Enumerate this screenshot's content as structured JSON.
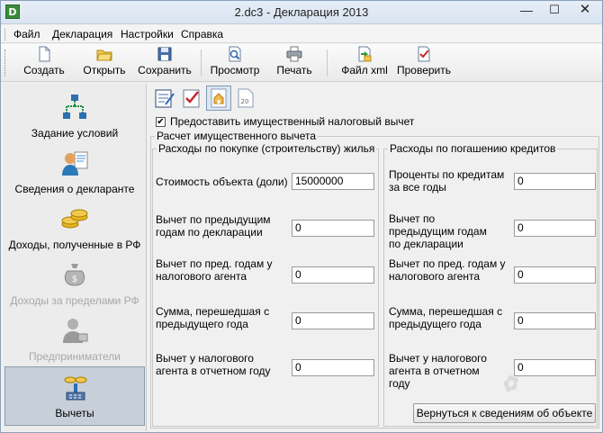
{
  "window": {
    "title": "2.dc3 - Декларация 2013"
  },
  "menu": [
    "Файл",
    "Декларация",
    "Настройки",
    "Справка"
  ],
  "toolbar": {
    "create": "Создать",
    "open": "Открыть",
    "save": "Сохранить",
    "preview": "Просмотр",
    "print": "Печать",
    "xml": "Файл xml",
    "check": "Проверить"
  },
  "sidebar": [
    {
      "label": "Задание условий"
    },
    {
      "label": "Сведения о декларанте"
    },
    {
      "label": "Доходы, полученные в РФ"
    },
    {
      "label": "Доходы за пределами РФ"
    },
    {
      "label": "Предприниматели"
    },
    {
      "label": "Вычеты"
    }
  ],
  "form": {
    "checkbox_label": "Предоставить имущественный налоговый вычет",
    "checkbox_checked": true,
    "section_title": "Расчет имущественного вычета",
    "purchase": {
      "title": "Расходы по покупке (строительству) жилья",
      "cost_label": "Стоимость объекта (доли)",
      "cost_value": "15000000",
      "prev_decl_label": "Вычет по предыдущим годам по декларации",
      "prev_decl_value": "0",
      "prev_agent_label": "Вычет по пред. годам у налогового агента",
      "prev_agent_value": "0",
      "carry_label": "Сумма, перешедшая с предыдущего года",
      "carry_value": "0",
      "agent_current_label": "Вычет у налогового агента в отчетном году",
      "agent_current_value": "0"
    },
    "loans": {
      "title": "Расходы по погашению кредитов",
      "interest_label": "Проценты по кредитам за все годы",
      "interest_value": "0",
      "prev_decl_label": "Вычет по предыдущим годам по декларации",
      "prev_decl_value": "0",
      "prev_agent_label": "Вычет по пред. годам у налогового агента",
      "prev_agent_value": "0",
      "carry_label": "Сумма, перешедшая с предыдущего года",
      "carry_value": "0",
      "agent_current_label": "Вычет у налогового агента в отчетном году",
      "agent_current_value": "0"
    },
    "back_button": "Вернуться к сведениям об объекте"
  },
  "colors": {
    "active_sidebar": "#c7cfd9",
    "disabled_text": "#a8a8a8"
  }
}
